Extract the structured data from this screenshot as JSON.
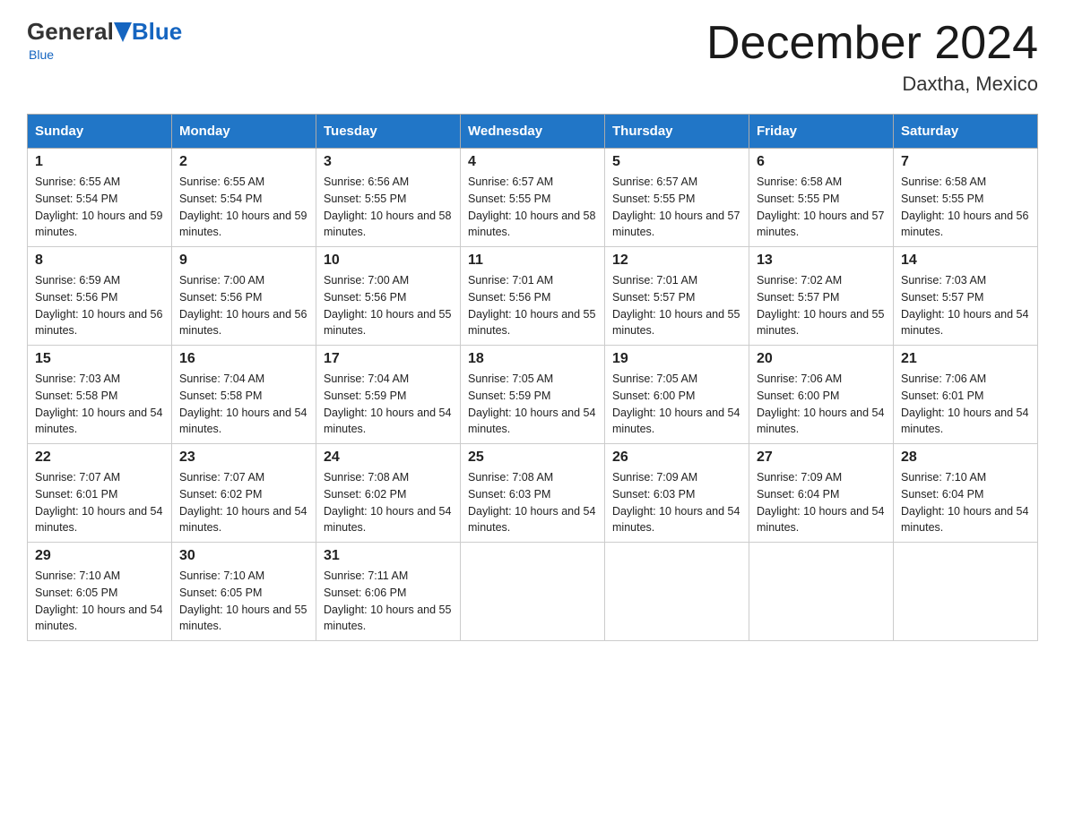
{
  "header": {
    "logo_general": "General",
    "logo_blue": "Blue",
    "month_title": "December 2024",
    "location": "Daxtha, Mexico"
  },
  "weekdays": [
    "Sunday",
    "Monday",
    "Tuesday",
    "Wednesday",
    "Thursday",
    "Friday",
    "Saturday"
  ],
  "weeks": [
    [
      {
        "day": "1",
        "sunrise": "6:55 AM",
        "sunset": "5:54 PM",
        "daylight": "10 hours and 59 minutes."
      },
      {
        "day": "2",
        "sunrise": "6:55 AM",
        "sunset": "5:54 PM",
        "daylight": "10 hours and 59 minutes."
      },
      {
        "day": "3",
        "sunrise": "6:56 AM",
        "sunset": "5:55 PM",
        "daylight": "10 hours and 58 minutes."
      },
      {
        "day": "4",
        "sunrise": "6:57 AM",
        "sunset": "5:55 PM",
        "daylight": "10 hours and 58 minutes."
      },
      {
        "day": "5",
        "sunrise": "6:57 AM",
        "sunset": "5:55 PM",
        "daylight": "10 hours and 57 minutes."
      },
      {
        "day": "6",
        "sunrise": "6:58 AM",
        "sunset": "5:55 PM",
        "daylight": "10 hours and 57 minutes."
      },
      {
        "day": "7",
        "sunrise": "6:58 AM",
        "sunset": "5:55 PM",
        "daylight": "10 hours and 56 minutes."
      }
    ],
    [
      {
        "day": "8",
        "sunrise": "6:59 AM",
        "sunset": "5:56 PM",
        "daylight": "10 hours and 56 minutes."
      },
      {
        "day": "9",
        "sunrise": "7:00 AM",
        "sunset": "5:56 PM",
        "daylight": "10 hours and 56 minutes."
      },
      {
        "day": "10",
        "sunrise": "7:00 AM",
        "sunset": "5:56 PM",
        "daylight": "10 hours and 55 minutes."
      },
      {
        "day": "11",
        "sunrise": "7:01 AM",
        "sunset": "5:56 PM",
        "daylight": "10 hours and 55 minutes."
      },
      {
        "day": "12",
        "sunrise": "7:01 AM",
        "sunset": "5:57 PM",
        "daylight": "10 hours and 55 minutes."
      },
      {
        "day": "13",
        "sunrise": "7:02 AM",
        "sunset": "5:57 PM",
        "daylight": "10 hours and 55 minutes."
      },
      {
        "day": "14",
        "sunrise": "7:03 AM",
        "sunset": "5:57 PM",
        "daylight": "10 hours and 54 minutes."
      }
    ],
    [
      {
        "day": "15",
        "sunrise": "7:03 AM",
        "sunset": "5:58 PM",
        "daylight": "10 hours and 54 minutes."
      },
      {
        "day": "16",
        "sunrise": "7:04 AM",
        "sunset": "5:58 PM",
        "daylight": "10 hours and 54 minutes."
      },
      {
        "day": "17",
        "sunrise": "7:04 AM",
        "sunset": "5:59 PM",
        "daylight": "10 hours and 54 minutes."
      },
      {
        "day": "18",
        "sunrise": "7:05 AM",
        "sunset": "5:59 PM",
        "daylight": "10 hours and 54 minutes."
      },
      {
        "day": "19",
        "sunrise": "7:05 AM",
        "sunset": "6:00 PM",
        "daylight": "10 hours and 54 minutes."
      },
      {
        "day": "20",
        "sunrise": "7:06 AM",
        "sunset": "6:00 PM",
        "daylight": "10 hours and 54 minutes."
      },
      {
        "day": "21",
        "sunrise": "7:06 AM",
        "sunset": "6:01 PM",
        "daylight": "10 hours and 54 minutes."
      }
    ],
    [
      {
        "day": "22",
        "sunrise": "7:07 AM",
        "sunset": "6:01 PM",
        "daylight": "10 hours and 54 minutes."
      },
      {
        "day": "23",
        "sunrise": "7:07 AM",
        "sunset": "6:02 PM",
        "daylight": "10 hours and 54 minutes."
      },
      {
        "day": "24",
        "sunrise": "7:08 AM",
        "sunset": "6:02 PM",
        "daylight": "10 hours and 54 minutes."
      },
      {
        "day": "25",
        "sunrise": "7:08 AM",
        "sunset": "6:03 PM",
        "daylight": "10 hours and 54 minutes."
      },
      {
        "day": "26",
        "sunrise": "7:09 AM",
        "sunset": "6:03 PM",
        "daylight": "10 hours and 54 minutes."
      },
      {
        "day": "27",
        "sunrise": "7:09 AM",
        "sunset": "6:04 PM",
        "daylight": "10 hours and 54 minutes."
      },
      {
        "day": "28",
        "sunrise": "7:10 AM",
        "sunset": "6:04 PM",
        "daylight": "10 hours and 54 minutes."
      }
    ],
    [
      {
        "day": "29",
        "sunrise": "7:10 AM",
        "sunset": "6:05 PM",
        "daylight": "10 hours and 54 minutes."
      },
      {
        "day": "30",
        "sunrise": "7:10 AM",
        "sunset": "6:05 PM",
        "daylight": "10 hours and 55 minutes."
      },
      {
        "day": "31",
        "sunrise": "7:11 AM",
        "sunset": "6:06 PM",
        "daylight": "10 hours and 55 minutes."
      },
      null,
      null,
      null,
      null
    ]
  ],
  "labels": {
    "sunrise_prefix": "Sunrise: ",
    "sunset_prefix": "Sunset: ",
    "daylight_prefix": "Daylight: "
  }
}
